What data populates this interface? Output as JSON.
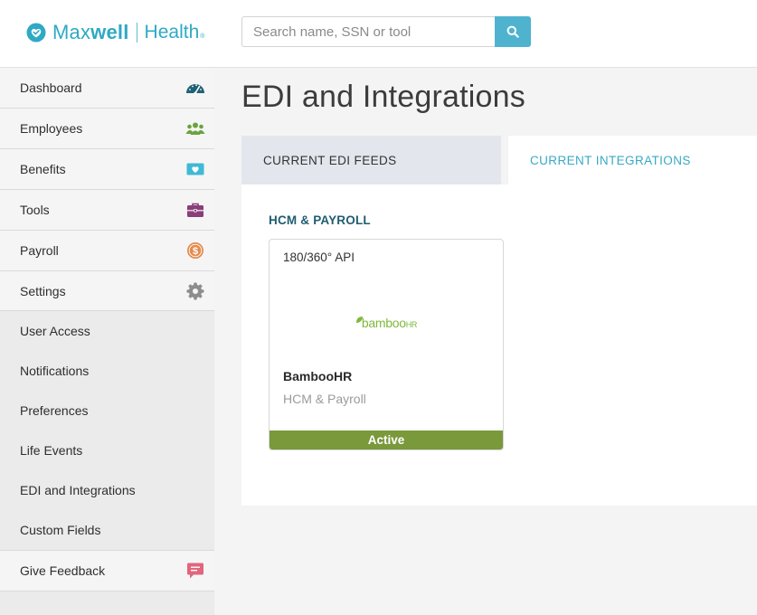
{
  "brand": {
    "name_light": "Max",
    "name_bold": "well",
    "name_health": "Health",
    "tm": "®"
  },
  "search": {
    "placeholder": "Search name, SSN or tool"
  },
  "sidebar": {
    "items": [
      {
        "label": "Dashboard",
        "icon": "dashboard-gauge-icon"
      },
      {
        "label": "Employees",
        "icon": "employees-group-icon"
      },
      {
        "label": "Benefits",
        "icon": "benefits-heart-icon"
      },
      {
        "label": "Tools",
        "icon": "tools-briefcase-icon"
      },
      {
        "label": "Payroll",
        "icon": "payroll-dollar-icon"
      },
      {
        "label": "Settings",
        "icon": "settings-gear-icon"
      }
    ],
    "sub_items": [
      {
        "label": "User Access"
      },
      {
        "label": "Notifications"
      },
      {
        "label": "Preferences"
      },
      {
        "label": "Life Events"
      },
      {
        "label": "EDI and Integrations"
      },
      {
        "label": "Custom Fields"
      }
    ],
    "feedback": {
      "label": "Give Feedback",
      "icon": "feedback-chat-icon"
    }
  },
  "main": {
    "title": "EDI and Integrations",
    "tabs": [
      {
        "label": "CURRENT EDI FEEDS",
        "active": false
      },
      {
        "label": "CURRENT INTEGRATIONS",
        "active": true
      }
    ],
    "section_title": "HCM & PAYROLL",
    "card": {
      "api": "180/360° API",
      "logo_text": "bamboo",
      "logo_suffix": "HR",
      "name": "BambooHR",
      "category": "HCM & Payroll",
      "status": "Active"
    }
  },
  "colors": {
    "brand": "#2fa9c4",
    "search_button": "#4fb3cf",
    "active_tab_text": "#3aa9c6",
    "section_title": "#1f5d70",
    "status_active": "#79993b",
    "bamboo_green": "#7fb83a"
  }
}
